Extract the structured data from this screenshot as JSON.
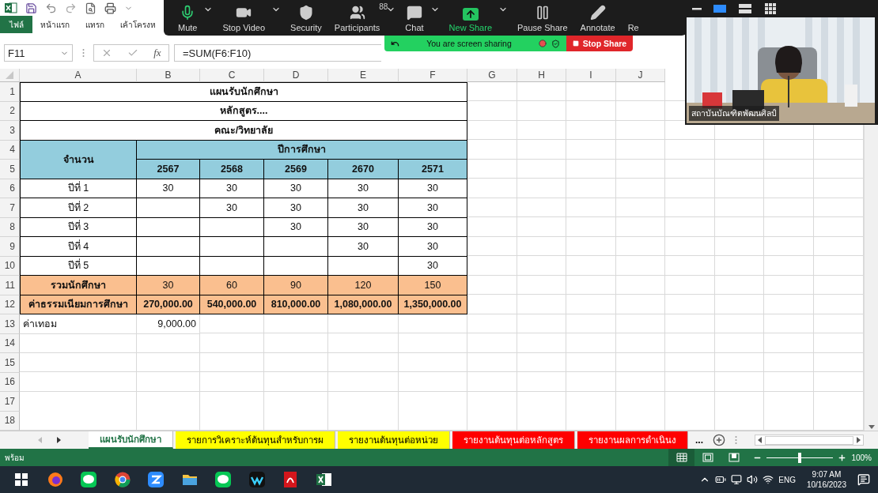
{
  "ribbon_tabs": [
    {
      "label": "ไฟล์",
      "kind": "file"
    },
    {
      "label": "หน้าแรก",
      "kind": "tab"
    },
    {
      "label": "แทรก",
      "kind": "tab"
    },
    {
      "label": "เค้าโครงห",
      "kind": "tab"
    }
  ],
  "formula_bar": {
    "name_box": "F11",
    "function_label": "fx",
    "formula": "=SUM(F6:F10)"
  },
  "sheet": {
    "columns": [
      "A",
      "B",
      "C",
      "D",
      "E",
      "F",
      "G",
      "H",
      "I",
      "J"
    ],
    "rows": [
      {
        "number": "1",
        "kind": "title",
        "text": "แผนรับนักศึกษา"
      },
      {
        "number": "2",
        "kind": "title",
        "text": "หลักสูตร...."
      },
      {
        "number": "3",
        "kind": "title",
        "text": "คณะ/วิทยาลัย"
      },
      {
        "number": "4",
        "kind": "group_header",
        "label": "จำนวน",
        "group": "ปีการศึกษา"
      },
      {
        "number": "5",
        "kind": "years",
        "values": [
          "2567",
          "2568",
          "2569",
          "2670",
          "2571"
        ]
      },
      {
        "number": "6",
        "kind": "data",
        "label": "ปีที่ 1",
        "values": [
          "30",
          "30",
          "30",
          "30",
          "30"
        ]
      },
      {
        "number": "7",
        "kind": "data",
        "label": "ปีที่ 2",
        "values": [
          "30",
          "30",
          "30",
          "30"
        ]
      },
      {
        "number": "8",
        "kind": "data",
        "label": "ปีที่ 3",
        "values": [
          "30",
          "30",
          "30"
        ]
      },
      {
        "number": "9",
        "kind": "data",
        "label": "ปีที่ 4",
        "values": [
          "30",
          "30"
        ]
      },
      {
        "number": "10",
        "kind": "data",
        "label": "ปีที่ 5",
        "values": [
          "30"
        ]
      },
      {
        "number": "11",
        "kind": "total",
        "label": "รวมนักศึกษา",
        "values": [
          "30",
          "60",
          "90",
          "120",
          "150"
        ]
      },
      {
        "number": "12",
        "kind": "fee",
        "label": "ค่าธรรมเนียมการศึกษา",
        "values": [
          "270,000.00",
          "540,000.00",
          "810,000.00",
          "1,080,000.00",
          "1,350,000.00"
        ]
      },
      {
        "number": "13",
        "kind": "note",
        "label": "ค่าเทอม",
        "values": [
          "9,000.00"
        ]
      },
      {
        "number": "14",
        "kind": "empty"
      },
      {
        "number": "15",
        "kind": "empty"
      },
      {
        "number": "16",
        "kind": "empty"
      },
      {
        "number": "17",
        "kind": "empty"
      },
      {
        "number": "18",
        "kind": "empty"
      }
    ]
  },
  "sheet_tabs": [
    {
      "label": "แผนรับนักศึกษา",
      "selected": true
    },
    {
      "label": "รายการวิเคราะห์ต้นทุนสำหรับการผ",
      "selected": false,
      "color": "#ffff00"
    },
    {
      "label": "รายงานต้นทุนต่อหน่วย",
      "selected": false,
      "color": "#ffff00"
    },
    {
      "label": "รายงานต้นทุนต่อหลักสูตร",
      "selected": false,
      "color": "#ff0000"
    },
    {
      "label": "รายงานผลการดำเนินง",
      "selected": false,
      "color": "#ff0000"
    }
  ],
  "more_tabs": "...",
  "status_bar": {
    "text": "พร้อม",
    "views": [
      {
        "kind": "normal",
        "selected": true
      },
      {
        "kind": "page_layout",
        "selected": false
      },
      {
        "kind": "page_break",
        "selected": false
      }
    ],
    "zoom": {
      "level": 0.5,
      "reading": "100%"
    }
  },
  "meeting_toolbar": {
    "buttons": [
      {
        "kind": "mute",
        "label": "Mute",
        "menu": true
      },
      {
        "kind": "video",
        "label": "Stop Video",
        "menu": true
      },
      {
        "kind": "security",
        "label": "Security",
        "menu": false
      },
      {
        "kind": "participants",
        "label": "Participants",
        "count": "88",
        "menu": true
      },
      {
        "kind": "chat",
        "label": "Chat",
        "menu": true
      },
      {
        "kind": "new_share",
        "label": "New Share",
        "menu": true
      },
      {
        "kind": "pause_share",
        "label": "Pause Share",
        "menu": false
      },
      {
        "kind": "annotate",
        "label": "Annotate",
        "menu": false
      },
      {
        "kind": "partial",
        "label": "Re",
        "menu": false
      }
    ]
  },
  "share_banner": {
    "text": "You are screen sharing",
    "stop_label": "Stop Share"
  },
  "video": {
    "view_options": [
      {
        "kind": "minimize",
        "selected": false
      },
      {
        "kind": "speaker",
        "selected": true
      },
      {
        "kind": "strip",
        "selected": false
      },
      {
        "kind": "gallery",
        "selected": false
      }
    ],
    "name": "สถาบันบัณฑิตพัฒนศิลป์"
  },
  "taskbar": {
    "apps": [
      {
        "kind": "start"
      },
      {
        "kind": "firefox"
      },
      {
        "kind": "chat"
      },
      {
        "kind": "chrome"
      },
      {
        "kind": "meeting"
      },
      {
        "kind": "folder"
      },
      {
        "kind": "chat"
      },
      {
        "kind": "webex"
      },
      {
        "kind": "pdf"
      },
      {
        "kind": "sheet"
      }
    ],
    "language": "ENG",
    "time": "9:07 AM",
    "date": "10/16/2023"
  }
}
